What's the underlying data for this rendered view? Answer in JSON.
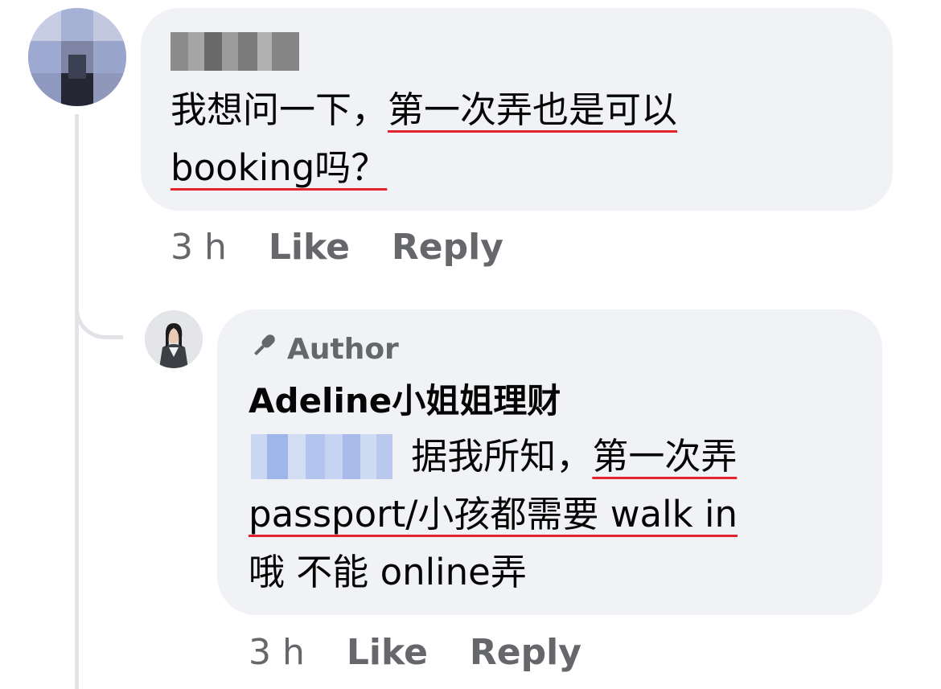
{
  "comment": {
    "time": "3 h",
    "like_label": "Like",
    "reply_label": "Reply",
    "text_plain_1": "我想问一下，",
    "text_underlined_1": "第一次弄也是可以",
    "text_underlined_2": "booking吗？"
  },
  "reply": {
    "badge_label": "Author",
    "author_name": "Adeline小姐姐理财",
    "text_plain_1": " 据我所知，",
    "text_underlined_1": "第一次弄",
    "text_underlined_2": "passport/小孩都需要 walk in",
    "text_plain_2": "哦 不能 online弄",
    "time": "3 h",
    "like_label": "Like",
    "reply_label": "Reply"
  },
  "colors": {
    "bubble": "#f0f2f5",
    "underline": "#e4232c",
    "secondary_text": "#65676b",
    "thread_line": "#e1e3e7"
  },
  "icons": {
    "author_badge": "microphone-icon"
  }
}
